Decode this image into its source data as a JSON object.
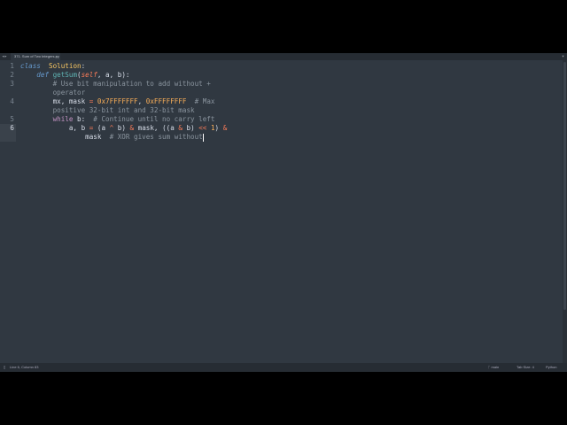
{
  "tab": {
    "title": "371. Sum of Two Integers.py",
    "close": "×"
  },
  "icons": {
    "nav": "◂▸",
    "tabs_menu": "▾"
  },
  "editor": {
    "current_line": 6,
    "lines": [
      {
        "num": "1",
        "tokens": [
          [
            "kw",
            "class"
          ],
          [
            "",
            "  "
          ],
          [
            "cls",
            "Solution"
          ],
          [
            "",
            ":"
          ]
        ]
      },
      {
        "num": "2",
        "tokens": [
          [
            "",
            "    "
          ],
          [
            "kw",
            "def"
          ],
          [
            "",
            " "
          ],
          [
            "fn",
            "getSum"
          ],
          [
            "",
            "("
          ],
          [
            "self",
            "self"
          ],
          [
            "",
            ", a, b):"
          ]
        ]
      },
      {
        "num": "3",
        "tokens": [
          [
            "",
            "        "
          ],
          [
            "cm",
            "# Use bit manipulation to add without +"
          ]
        ]
      },
      {
        "num": "",
        "tokens": [
          [
            "",
            "        "
          ],
          [
            "cm",
            "operator"
          ]
        ]
      },
      {
        "num": "4",
        "tokens": [
          [
            "",
            "        mx, mask "
          ],
          [
            "op",
            "="
          ],
          [
            "",
            " "
          ],
          [
            "num",
            "0x7FFFFFFF"
          ],
          [
            "",
            ", "
          ],
          [
            "num",
            "0xFFFFFFFF"
          ],
          [
            "",
            "  "
          ],
          [
            "cm",
            "# Max"
          ]
        ]
      },
      {
        "num": "",
        "tokens": [
          [
            "",
            "        "
          ],
          [
            "cm",
            "positive 32-bit int and 32-bit mask"
          ]
        ]
      },
      {
        "num": "5",
        "tokens": [
          [
            "",
            "        "
          ],
          [
            "kw2",
            "while"
          ],
          [
            "",
            " b:  "
          ],
          [
            "cm",
            "# Continue until no carry left"
          ]
        ]
      },
      {
        "num": "6",
        "tokens": [
          [
            "",
            "            a, b "
          ],
          [
            "op",
            "="
          ],
          [
            "",
            " (a "
          ],
          [
            "op",
            "^"
          ],
          [
            "",
            " b) "
          ],
          [
            "op",
            "&"
          ],
          [
            "",
            " mask, ((a "
          ],
          [
            "op",
            "&"
          ],
          [
            "",
            " b) "
          ],
          [
            "op",
            "<<"
          ],
          [
            "",
            " "
          ],
          [
            "num",
            "1"
          ],
          [
            "",
            ") "
          ],
          [
            "op",
            "&"
          ]
        ]
      },
      {
        "num": "",
        "tokens": [
          [
            "",
            "                mask  "
          ],
          [
            "cm",
            "# XOR gives sum without"
          ]
        ],
        "cursor": true
      }
    ]
  },
  "status": {
    "position": "Line 6, Column 83",
    "branch": "main",
    "tab_size": "Tab Size: 4",
    "syntax": "Python"
  }
}
